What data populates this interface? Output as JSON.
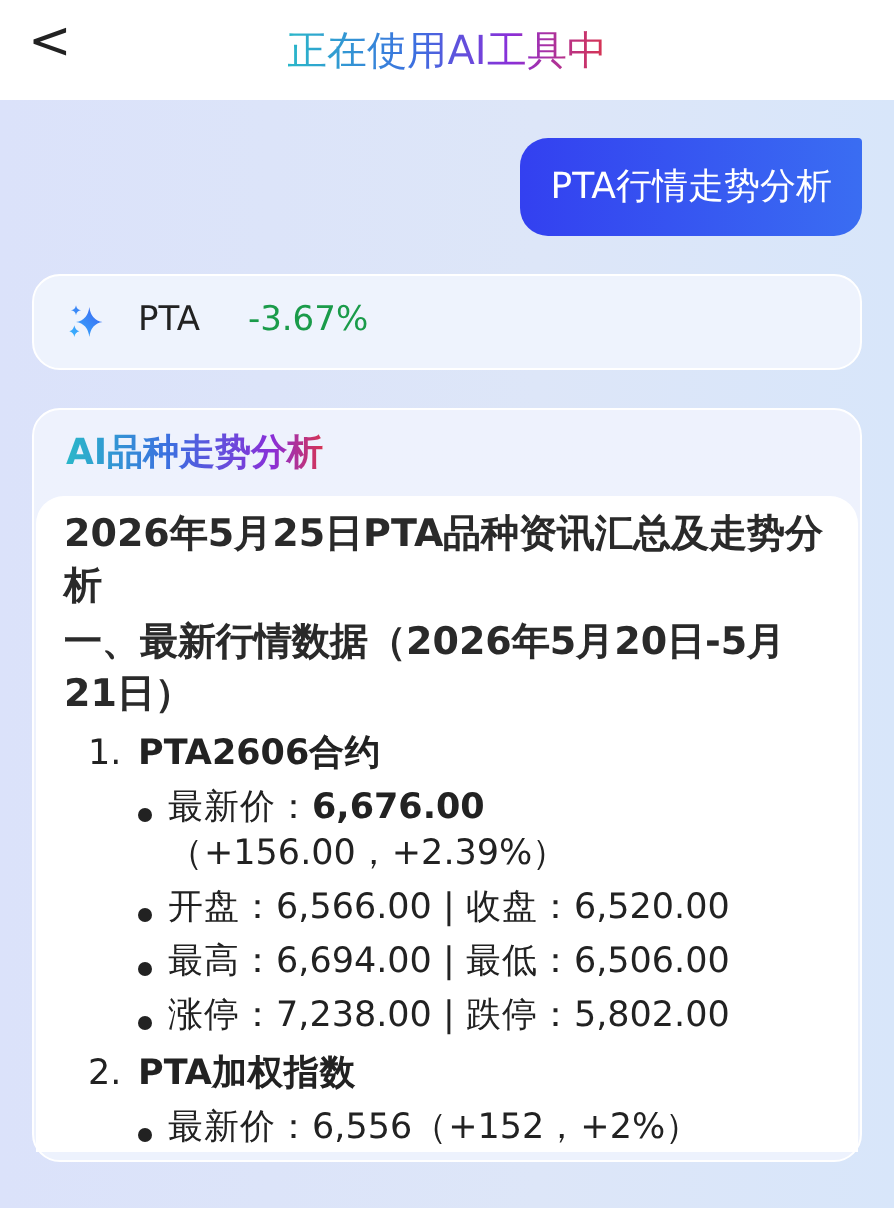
{
  "header": {
    "back": "<",
    "title": "正在使用AI工具中"
  },
  "user_message": "PTA行情走势分析",
  "quote": {
    "symbol": "PTA",
    "change": "-3.67%"
  },
  "analysis": {
    "heading": "AI品种走势分析",
    "title": "2026年5月25日PTA品种资讯汇总及走势分析",
    "section": "一、最新行情数据（2026年5月20日-5月21日）",
    "items": [
      {
        "number": "1.",
        "title": "PTA2606合约",
        "bullets": [
          "最新价：**6,676.00**（+156.00，+2.39%）",
          "开盘：6,566.00 | 收盘：6,520.00",
          "最高：6,694.00 | 最低：6,506.00",
          "涨停：7,238.00 | 跌停：5,802.00"
        ]
      },
      {
        "number": "2.",
        "title": "PTA加权指数",
        "bullets": [
          "最新价：6,556（+152，+2%）"
        ]
      }
    ]
  }
}
